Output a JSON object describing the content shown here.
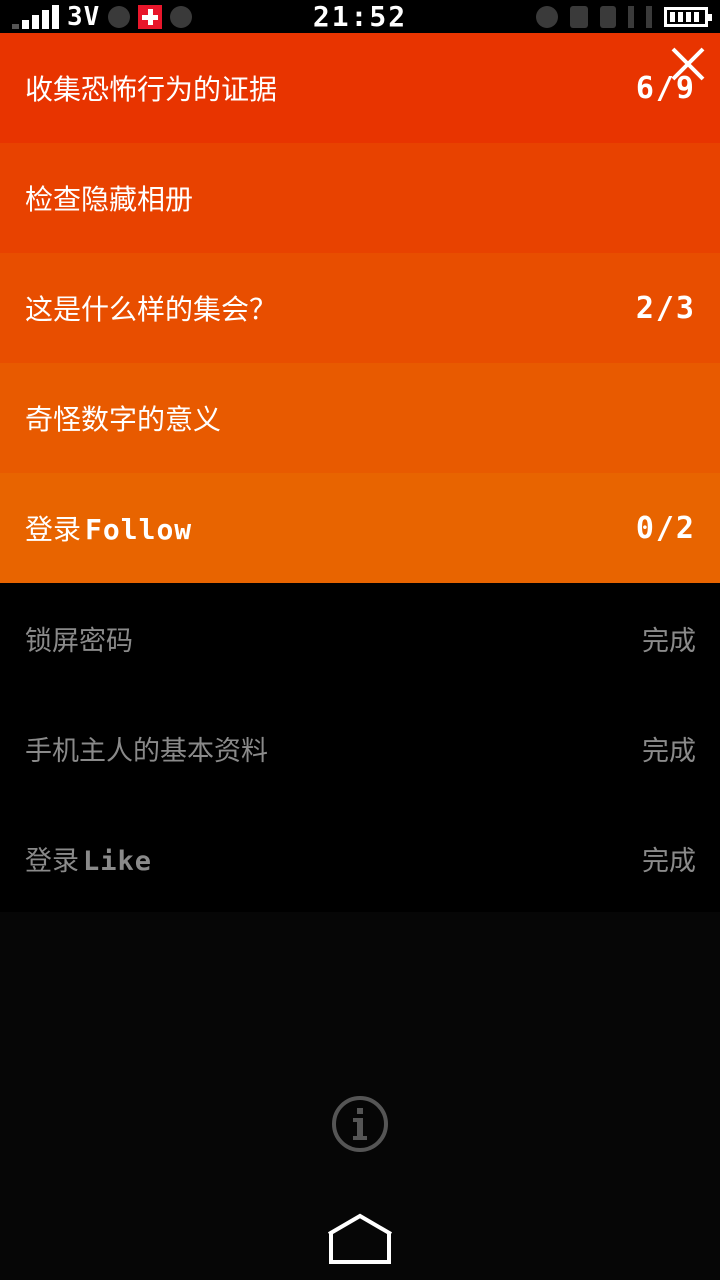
{
  "status_bar": {
    "network_type": "3V",
    "time": "21:52"
  },
  "tasks": [
    {
      "label": "收集恐怖行为的证据",
      "latin": "",
      "count": "6/9"
    },
    {
      "label": "检查隐藏相册",
      "latin": "",
      "count": ""
    },
    {
      "label": "这是什么样的集会？",
      "latin": "",
      "count": "2/3"
    },
    {
      "label": "奇怪数字的意义",
      "latin": "",
      "count": ""
    },
    {
      "label": "登录",
      "latin": "Follow",
      "count": "0/2"
    }
  ],
  "completed": [
    {
      "label": "锁屏密码",
      "latin": "",
      "status": "完成"
    },
    {
      "label": "手机主人的基本资料",
      "latin": "",
      "status": "完成"
    },
    {
      "label": "登录",
      "latin": "Like",
      "status": "完成"
    }
  ],
  "colors": {
    "task_gradient": [
      "#e83400",
      "#e84200",
      "#e84e00",
      "#e85a00",
      "#e86400"
    ],
    "completed_text": "#8a8a8a",
    "background": "#000000"
  },
  "icons": {
    "close": "close-icon",
    "info": "info-icon",
    "home": "home-icon"
  }
}
